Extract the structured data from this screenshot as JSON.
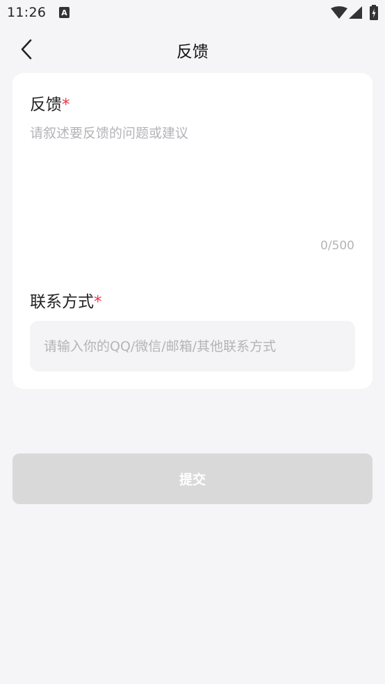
{
  "status_bar": {
    "time": "11:26",
    "notification_icon": "a-icon",
    "notification_letter": "A",
    "icons": [
      "wifi-icon",
      "signal-icon",
      "battery-icon"
    ]
  },
  "header": {
    "back_icon": "chevron-left-icon",
    "title": "反馈"
  },
  "form": {
    "feedback": {
      "label": "反馈",
      "required_mark": "*",
      "placeholder": "请叙述要反馈的问题或建议",
      "value": "",
      "char_count": "0/500"
    },
    "contact": {
      "label": "联系方式",
      "required_mark": "*",
      "placeholder": "请输入你的QQ/微信/邮箱/其他联系方式",
      "value": ""
    }
  },
  "submit": {
    "label": "提交",
    "enabled": false
  },
  "colors": {
    "background": "#f5f5f7",
    "card": "#ffffff",
    "required": "#ee3344",
    "placeholder": "#b4b4b8",
    "input_bg": "#f4f4f6",
    "submit_disabled": "#d9d9d9"
  }
}
